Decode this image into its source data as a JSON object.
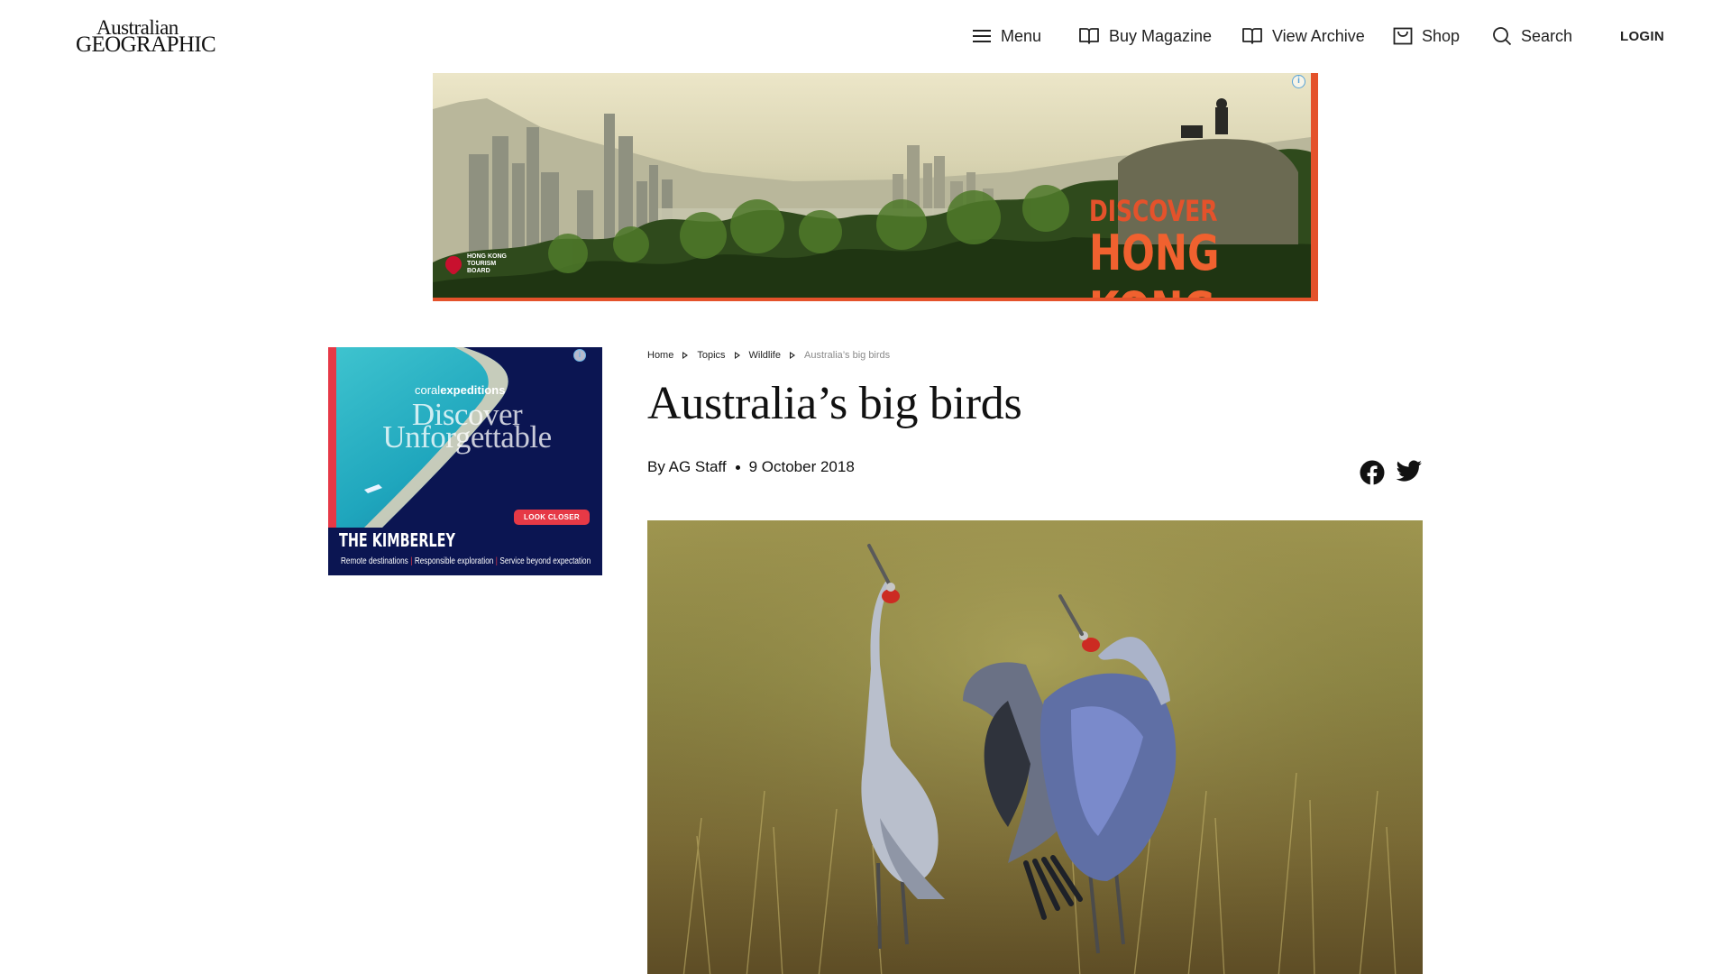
{
  "header": {
    "logo": {
      "line1": "Australian",
      "line2": "GEOGRAPHIC"
    },
    "nav": {
      "menu": "Menu",
      "buy_magazine": "Buy Magazine",
      "view_archive": "View Archive",
      "shop": "Shop",
      "search": "Search",
      "login": "LOGIN"
    }
  },
  "banner_ad": {
    "line1": "DISCOVER",
    "line2": "HONG KONG",
    "sponsor": "HONG KONG TOURISM BOARD",
    "info_icon": "i",
    "accent_color": "#e4522b"
  },
  "side_ad": {
    "brand_prefix": "coral",
    "brand_suffix": "expeditions",
    "headline_1": "Discover",
    "headline_2": "Unforgettable",
    "cta": "LOOK CLOSER",
    "region": "THE KIMBERLEY",
    "tagline_1": "Remote destinations",
    "tagline_2": "Responsible exploration",
    "tagline_3": "Service beyond expectation",
    "info_icon": "i",
    "accent_color": "#e63946"
  },
  "article": {
    "breadcrumb": [
      "Home",
      "Topics",
      "Wildlife",
      "Australia’s big birds"
    ],
    "title": "Australia’s big birds",
    "author": "By AG Staff",
    "date": "9 October 2018",
    "share_icons": [
      "facebook-icon",
      "twitter-icon"
    ]
  }
}
